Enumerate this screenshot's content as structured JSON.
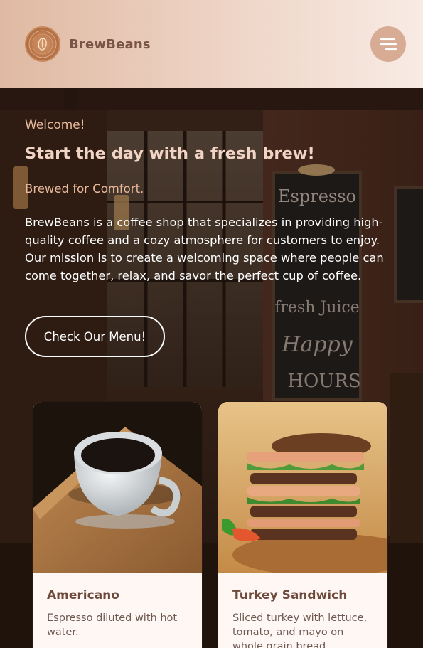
{
  "header": {
    "brand_name": "BrewBeans",
    "logo_icon": "coffee-shop-logo",
    "menu_icon": "hamburger-menu-icon",
    "colors": {
      "header_start": "#dfb9a3",
      "header_end": "#f8ebe4",
      "brand_text": "#7a5547",
      "menu_button": "#d8ab95"
    }
  },
  "hero": {
    "welcome": "Welcome!",
    "headline": "Start the day with a fresh brew!",
    "tagline": "Brewed for Comfort.",
    "description": "BrewBeans is a coffee shop that specializes in providing high-quality coffee and a cozy atmosphere for customers to enjoy. Our mission is to create a welcoming space where people can come together, relax, and savor the perfect cup of coffee.",
    "cta_label": "Check Our Menu!",
    "colors": {
      "accent": "#e9b99b",
      "headline": "#f1d4c3",
      "body_text": "#ffffff"
    }
  },
  "cards": [
    {
      "title": "Americano",
      "description": "Espresso diluted with hot water.",
      "image": "coffee-cup-image"
    },
    {
      "title": "Turkey Sandwich",
      "description": "Sliced turkey with lettuce, tomato, and mayo on whole grain bread.",
      "image": "sandwich-image"
    }
  ]
}
